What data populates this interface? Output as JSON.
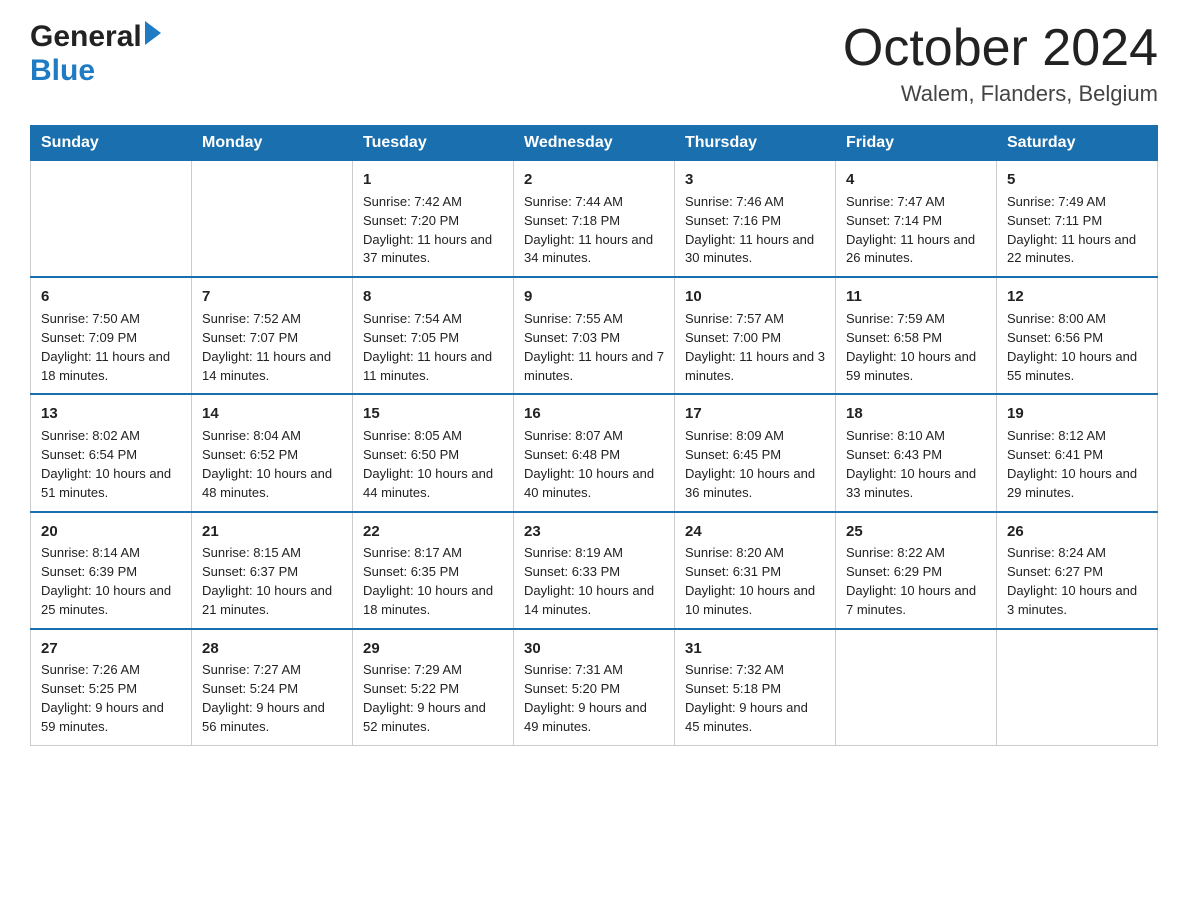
{
  "header": {
    "logo_general": "General",
    "logo_blue": "Blue",
    "month_title": "October 2024",
    "location": "Walem, Flanders, Belgium"
  },
  "days_of_week": [
    "Sunday",
    "Monday",
    "Tuesday",
    "Wednesday",
    "Thursday",
    "Friday",
    "Saturday"
  ],
  "weeks": [
    [
      {
        "day": "",
        "sunrise": "",
        "sunset": "",
        "daylight": ""
      },
      {
        "day": "",
        "sunrise": "",
        "sunset": "",
        "daylight": ""
      },
      {
        "day": "1",
        "sunrise": "Sunrise: 7:42 AM",
        "sunset": "Sunset: 7:20 PM",
        "daylight": "Daylight: 11 hours and 37 minutes."
      },
      {
        "day": "2",
        "sunrise": "Sunrise: 7:44 AM",
        "sunset": "Sunset: 7:18 PM",
        "daylight": "Daylight: 11 hours and 34 minutes."
      },
      {
        "day": "3",
        "sunrise": "Sunrise: 7:46 AM",
        "sunset": "Sunset: 7:16 PM",
        "daylight": "Daylight: 11 hours and 30 minutes."
      },
      {
        "day": "4",
        "sunrise": "Sunrise: 7:47 AM",
        "sunset": "Sunset: 7:14 PM",
        "daylight": "Daylight: 11 hours and 26 minutes."
      },
      {
        "day": "5",
        "sunrise": "Sunrise: 7:49 AM",
        "sunset": "Sunset: 7:11 PM",
        "daylight": "Daylight: 11 hours and 22 minutes."
      }
    ],
    [
      {
        "day": "6",
        "sunrise": "Sunrise: 7:50 AM",
        "sunset": "Sunset: 7:09 PM",
        "daylight": "Daylight: 11 hours and 18 minutes."
      },
      {
        "day": "7",
        "sunrise": "Sunrise: 7:52 AM",
        "sunset": "Sunset: 7:07 PM",
        "daylight": "Daylight: 11 hours and 14 minutes."
      },
      {
        "day": "8",
        "sunrise": "Sunrise: 7:54 AM",
        "sunset": "Sunset: 7:05 PM",
        "daylight": "Daylight: 11 hours and 11 minutes."
      },
      {
        "day": "9",
        "sunrise": "Sunrise: 7:55 AM",
        "sunset": "Sunset: 7:03 PM",
        "daylight": "Daylight: 11 hours and 7 minutes."
      },
      {
        "day": "10",
        "sunrise": "Sunrise: 7:57 AM",
        "sunset": "Sunset: 7:00 PM",
        "daylight": "Daylight: 11 hours and 3 minutes."
      },
      {
        "day": "11",
        "sunrise": "Sunrise: 7:59 AM",
        "sunset": "Sunset: 6:58 PM",
        "daylight": "Daylight: 10 hours and 59 minutes."
      },
      {
        "day": "12",
        "sunrise": "Sunrise: 8:00 AM",
        "sunset": "Sunset: 6:56 PM",
        "daylight": "Daylight: 10 hours and 55 minutes."
      }
    ],
    [
      {
        "day": "13",
        "sunrise": "Sunrise: 8:02 AM",
        "sunset": "Sunset: 6:54 PM",
        "daylight": "Daylight: 10 hours and 51 minutes."
      },
      {
        "day": "14",
        "sunrise": "Sunrise: 8:04 AM",
        "sunset": "Sunset: 6:52 PM",
        "daylight": "Daylight: 10 hours and 48 minutes."
      },
      {
        "day": "15",
        "sunrise": "Sunrise: 8:05 AM",
        "sunset": "Sunset: 6:50 PM",
        "daylight": "Daylight: 10 hours and 44 minutes."
      },
      {
        "day": "16",
        "sunrise": "Sunrise: 8:07 AM",
        "sunset": "Sunset: 6:48 PM",
        "daylight": "Daylight: 10 hours and 40 minutes."
      },
      {
        "day": "17",
        "sunrise": "Sunrise: 8:09 AM",
        "sunset": "Sunset: 6:45 PM",
        "daylight": "Daylight: 10 hours and 36 minutes."
      },
      {
        "day": "18",
        "sunrise": "Sunrise: 8:10 AM",
        "sunset": "Sunset: 6:43 PM",
        "daylight": "Daylight: 10 hours and 33 minutes."
      },
      {
        "day": "19",
        "sunrise": "Sunrise: 8:12 AM",
        "sunset": "Sunset: 6:41 PM",
        "daylight": "Daylight: 10 hours and 29 minutes."
      }
    ],
    [
      {
        "day": "20",
        "sunrise": "Sunrise: 8:14 AM",
        "sunset": "Sunset: 6:39 PM",
        "daylight": "Daylight: 10 hours and 25 minutes."
      },
      {
        "day": "21",
        "sunrise": "Sunrise: 8:15 AM",
        "sunset": "Sunset: 6:37 PM",
        "daylight": "Daylight: 10 hours and 21 minutes."
      },
      {
        "day": "22",
        "sunrise": "Sunrise: 8:17 AM",
        "sunset": "Sunset: 6:35 PM",
        "daylight": "Daylight: 10 hours and 18 minutes."
      },
      {
        "day": "23",
        "sunrise": "Sunrise: 8:19 AM",
        "sunset": "Sunset: 6:33 PM",
        "daylight": "Daylight: 10 hours and 14 minutes."
      },
      {
        "day": "24",
        "sunrise": "Sunrise: 8:20 AM",
        "sunset": "Sunset: 6:31 PM",
        "daylight": "Daylight: 10 hours and 10 minutes."
      },
      {
        "day": "25",
        "sunrise": "Sunrise: 8:22 AM",
        "sunset": "Sunset: 6:29 PM",
        "daylight": "Daylight: 10 hours and 7 minutes."
      },
      {
        "day": "26",
        "sunrise": "Sunrise: 8:24 AM",
        "sunset": "Sunset: 6:27 PM",
        "daylight": "Daylight: 10 hours and 3 minutes."
      }
    ],
    [
      {
        "day": "27",
        "sunrise": "Sunrise: 7:26 AM",
        "sunset": "Sunset: 5:25 PM",
        "daylight": "Daylight: 9 hours and 59 minutes."
      },
      {
        "day": "28",
        "sunrise": "Sunrise: 7:27 AM",
        "sunset": "Sunset: 5:24 PM",
        "daylight": "Daylight: 9 hours and 56 minutes."
      },
      {
        "day": "29",
        "sunrise": "Sunrise: 7:29 AM",
        "sunset": "Sunset: 5:22 PM",
        "daylight": "Daylight: 9 hours and 52 minutes."
      },
      {
        "day": "30",
        "sunrise": "Sunrise: 7:31 AM",
        "sunset": "Sunset: 5:20 PM",
        "daylight": "Daylight: 9 hours and 49 minutes."
      },
      {
        "day": "31",
        "sunrise": "Sunrise: 7:32 AM",
        "sunset": "Sunset: 5:18 PM",
        "daylight": "Daylight: 9 hours and 45 minutes."
      },
      {
        "day": "",
        "sunrise": "",
        "sunset": "",
        "daylight": ""
      },
      {
        "day": "",
        "sunrise": "",
        "sunset": "",
        "daylight": ""
      }
    ]
  ]
}
